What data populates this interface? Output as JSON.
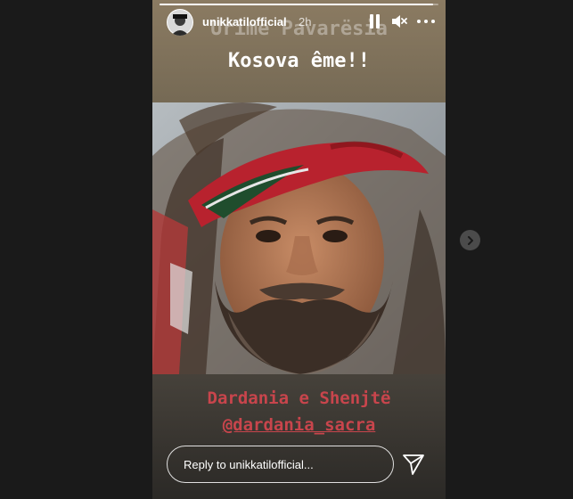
{
  "story": {
    "username": "unikkatilofficial",
    "time_ago": "2h",
    "progress": 0.98,
    "headline_line1": "Urime Pavarësia",
    "headline_line2": "Kosova ême!!",
    "caption_line1": "Dardania e Shenjtë",
    "caption_line2": "@dardania_sacra"
  },
  "reply": {
    "placeholder": "Reply to unikkatilofficial..."
  },
  "icons": {
    "pause": "pause-icon",
    "mute": "speaker-muted-icon",
    "more": "more-horizontal-icon",
    "send": "paper-plane-icon",
    "next": "chevron-right-icon"
  },
  "colors": {
    "background": "#1a1a1a",
    "caption": "#c8454c",
    "text": "#ffffff"
  }
}
